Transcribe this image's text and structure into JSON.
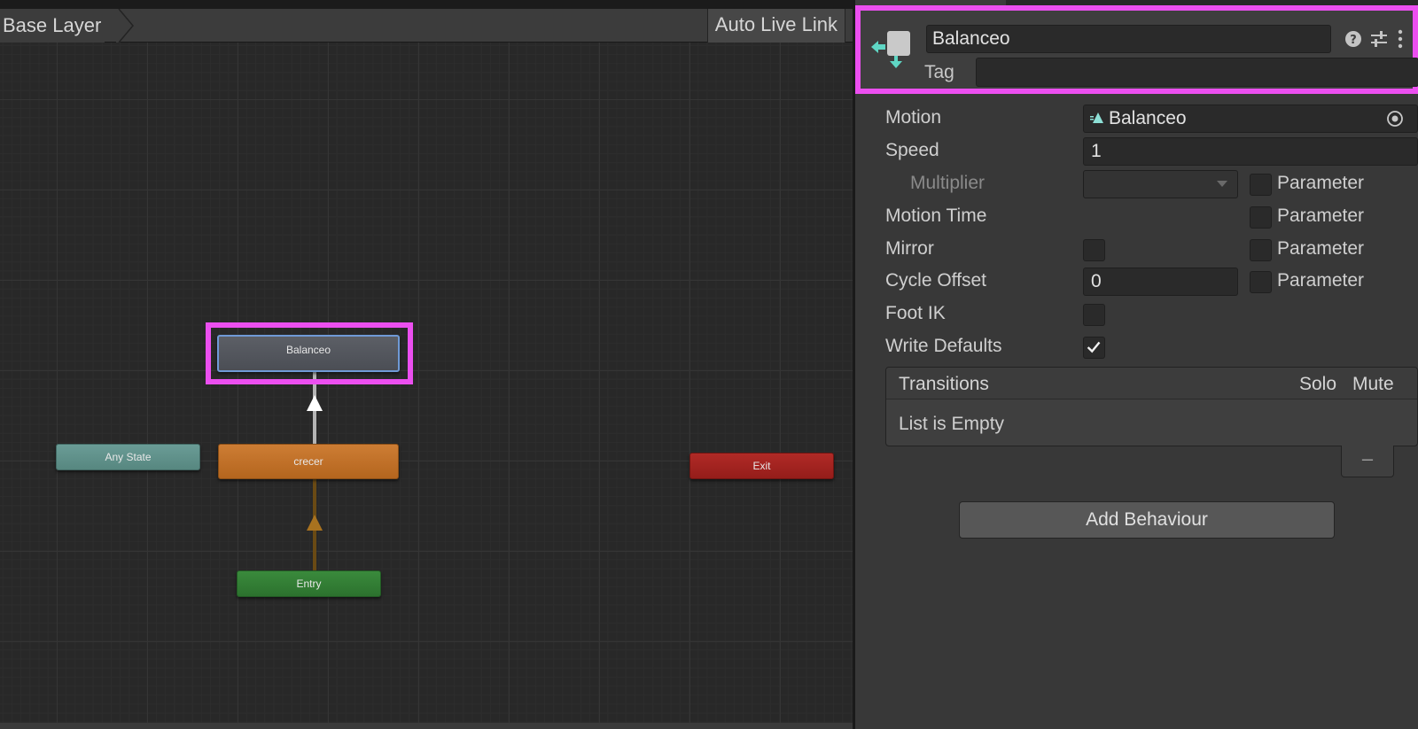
{
  "graph": {
    "breadcrumb": "Base Layer",
    "live_link_label": "Auto Live Link",
    "states": {
      "balanceo": "Balanceo",
      "crecer": "crecer",
      "any_state": "Any State",
      "entry": "Entry",
      "exit": "Exit"
    }
  },
  "inspector": {
    "state_name": "Balanceo",
    "tag_label": "Tag",
    "tag_value": "",
    "properties": {
      "motion_label": "Motion",
      "motion_value": "Balanceo",
      "speed_label": "Speed",
      "speed_value": "1",
      "multiplier_label": "Multiplier",
      "multiplier_value": "",
      "motion_time_label": "Motion Time",
      "mirror_label": "Mirror",
      "cycle_offset_label": "Cycle Offset",
      "cycle_offset_value": "0",
      "foot_ik_label": "Foot IK",
      "write_defaults_label": "Write Defaults",
      "parameter_label": "Parameter"
    },
    "checkboxes": {
      "multiplier_parameter": false,
      "motion_time_parameter": false,
      "mirror": false,
      "mirror_parameter": false,
      "cycle_offset_parameter": false,
      "foot_ik": false,
      "write_defaults": true
    },
    "transitions": {
      "title": "Transitions",
      "solo_label": "Solo",
      "mute_label": "Mute",
      "empty_text": "List is Empty",
      "remove_label": "–"
    },
    "add_behaviour_label": "Add Behaviour"
  },
  "colors": {
    "highlight": "#ec4ff0",
    "crecer_state": "#c2742b",
    "any_state": "#5f918a",
    "entry_state": "#33803a",
    "exit_state": "#a4231f",
    "selected_state": "#555860"
  }
}
